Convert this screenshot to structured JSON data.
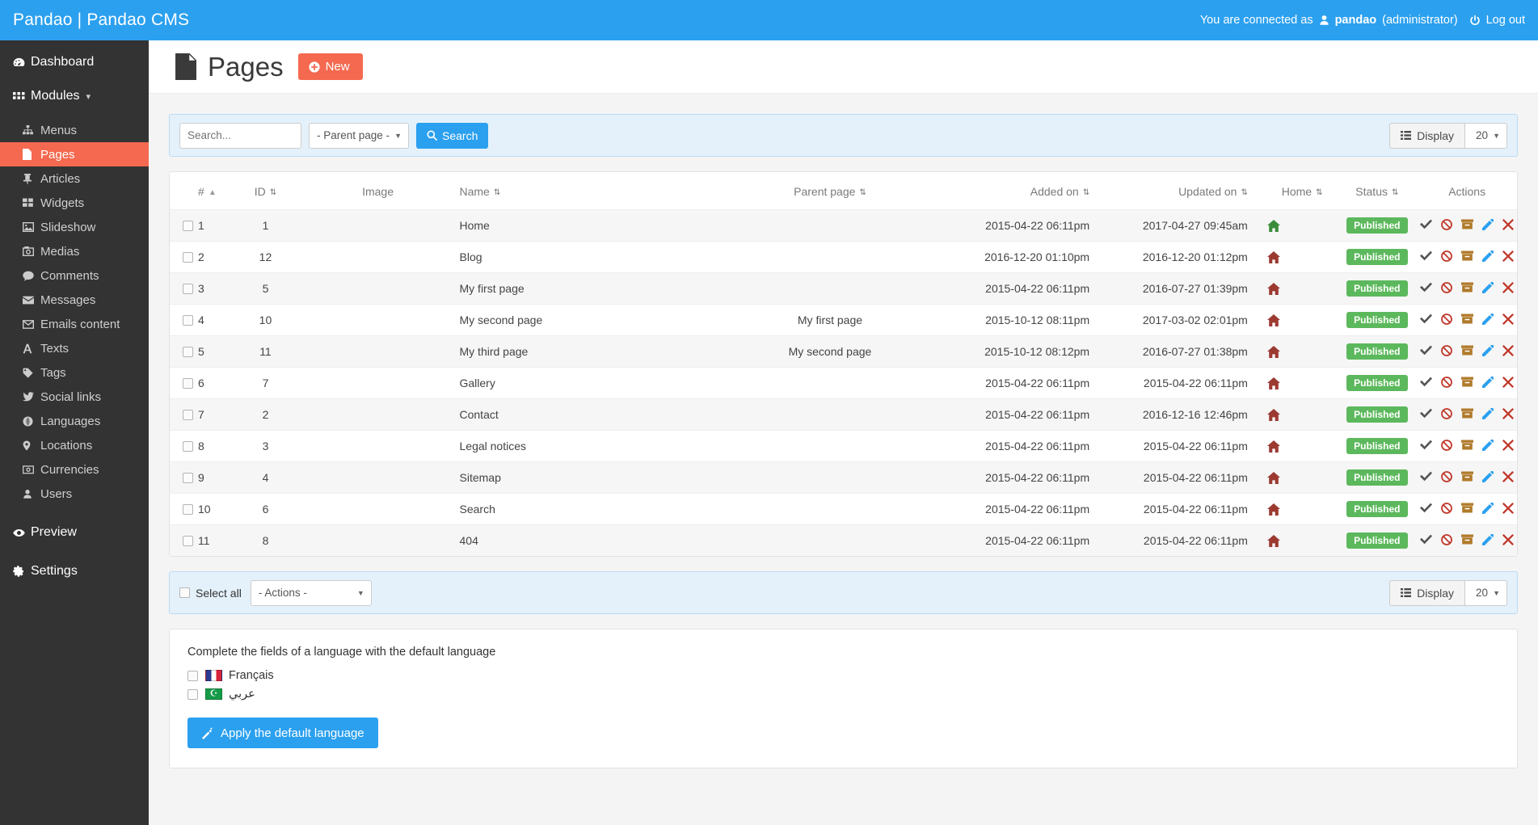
{
  "topbar": {
    "brand": "Pandao | Pandao CMS",
    "connected_label": "You are connected as",
    "user_icon": "user-icon",
    "username": "pandao",
    "role": "(administrator)",
    "power_icon": "power-icon",
    "logout_label": "Log out",
    "bg_color": "#2ba0ef"
  },
  "sidebar": {
    "bg_color": "#333333",
    "active_color": "#f4694f",
    "items": [
      {
        "label": "Dashboard",
        "icon": "dashboard-icon",
        "level": "top"
      },
      {
        "label": "Modules",
        "icon": "grid-icon",
        "level": "top",
        "caret": "chevron-down-icon"
      },
      {
        "label": "Menus",
        "icon": "sitemap-icon",
        "level": "sub"
      },
      {
        "label": "Pages",
        "icon": "page-icon",
        "level": "sub",
        "active": true
      },
      {
        "label": "Articles",
        "icon": "pin-icon",
        "level": "sub"
      },
      {
        "label": "Widgets",
        "icon": "widgets-icon",
        "level": "sub"
      },
      {
        "label": "Slideshow",
        "icon": "image-icon",
        "level": "sub"
      },
      {
        "label": "Medias",
        "icon": "camera-icon",
        "level": "sub"
      },
      {
        "label": "Comments",
        "icon": "comment-icon",
        "level": "sub"
      },
      {
        "label": "Messages",
        "icon": "envelope-icon",
        "level": "sub"
      },
      {
        "label": "Emails content",
        "icon": "envelope-open-icon",
        "level": "sub"
      },
      {
        "label": "Texts",
        "icon": "font-icon",
        "level": "sub"
      },
      {
        "label": "Tags",
        "icon": "tag-icon",
        "level": "sub"
      },
      {
        "label": "Social links",
        "icon": "twitter-icon",
        "level": "sub"
      },
      {
        "label": "Languages",
        "icon": "globe-icon",
        "level": "sub"
      },
      {
        "label": "Locations",
        "icon": "map-pin-icon",
        "level": "sub"
      },
      {
        "label": "Currencies",
        "icon": "money-icon",
        "level": "sub"
      },
      {
        "label": "Users",
        "icon": "user-icon",
        "level": "sub"
      },
      {
        "label": "Preview",
        "icon": "eye-icon",
        "level": "top"
      },
      {
        "label": "Settings",
        "icon": "gear-icon",
        "level": "top"
      }
    ]
  },
  "page": {
    "title": "Pages",
    "title_icon": "page-icon",
    "new_button": "New",
    "new_button_icon": "plus-circle-icon",
    "new_button_color": "#f4694f"
  },
  "search": {
    "placeholder": "Search...",
    "value": "",
    "parent_select": "- Parent page -",
    "search_button": "Search",
    "search_icon": "search-icon",
    "display_label": "Display",
    "display_icon": "list-icon",
    "display_count": "20"
  },
  "table": {
    "columns": [
      {
        "label": "#",
        "sort": "asc"
      },
      {
        "label": "ID",
        "sort": "both"
      },
      {
        "label": "Image",
        "sort": "none"
      },
      {
        "label": "Name",
        "sort": "both"
      },
      {
        "label": "Parent page",
        "sort": "both"
      },
      {
        "label": "Added on",
        "sort": "both"
      },
      {
        "label": "Updated on",
        "sort": "both"
      },
      {
        "label": "Home",
        "sort": "both"
      },
      {
        "label": "Status",
        "sort": "both"
      },
      {
        "label": "Actions",
        "sort": "none"
      }
    ],
    "rows": [
      {
        "num": "1",
        "id": "1",
        "image": "",
        "name": "Home",
        "parent": "",
        "added": "2015-04-22 06:11pm",
        "updated": "2017-04-27 09:45am",
        "home": "home-icon-active",
        "status": "Published"
      },
      {
        "num": "2",
        "id": "12",
        "image": "",
        "name": "Blog",
        "parent": "",
        "added": "2016-12-20 01:10pm",
        "updated": "2016-12-20 01:12pm",
        "home": "home-icon",
        "status": "Published"
      },
      {
        "num": "3",
        "id": "5",
        "image": "",
        "name": "My first page",
        "parent": "",
        "added": "2015-04-22 06:11pm",
        "updated": "2016-07-27 01:39pm",
        "home": "home-icon",
        "status": "Published"
      },
      {
        "num": "4",
        "id": "10",
        "image": "",
        "name": "My second page",
        "parent": "My first page",
        "added": "2015-10-12 08:11pm",
        "updated": "2017-03-02 02:01pm",
        "home": "home-icon",
        "status": "Published"
      },
      {
        "num": "5",
        "id": "11",
        "image": "",
        "name": "My third page",
        "parent": "My second page",
        "added": "2015-10-12 08:12pm",
        "updated": "2016-07-27 01:38pm",
        "home": "home-icon",
        "status": "Published"
      },
      {
        "num": "6",
        "id": "7",
        "image": "",
        "name": "Gallery",
        "parent": "",
        "added": "2015-04-22 06:11pm",
        "updated": "2015-04-22 06:11pm",
        "home": "home-icon",
        "status": "Published"
      },
      {
        "num": "7",
        "id": "2",
        "image": "",
        "name": "Contact",
        "parent": "",
        "added": "2015-04-22 06:11pm",
        "updated": "2016-12-16 12:46pm",
        "home": "home-icon",
        "status": "Published"
      },
      {
        "num": "8",
        "id": "3",
        "image": "",
        "name": "Legal notices",
        "parent": "",
        "added": "2015-04-22 06:11pm",
        "updated": "2015-04-22 06:11pm",
        "home": "home-icon",
        "status": "Published"
      },
      {
        "num": "9",
        "id": "4",
        "image": "",
        "name": "Sitemap",
        "parent": "",
        "added": "2015-04-22 06:11pm",
        "updated": "2015-04-22 06:11pm",
        "home": "home-icon",
        "status": "Published"
      },
      {
        "num": "10",
        "id": "6",
        "image": "",
        "name": "Search",
        "parent": "",
        "added": "2015-04-22 06:11pm",
        "updated": "2015-04-22 06:11pm",
        "home": "home-icon",
        "status": "Published"
      },
      {
        "num": "11",
        "id": "8",
        "image": "",
        "name": "404",
        "parent": "",
        "added": "2015-04-22 06:11pm",
        "updated": "2015-04-22 06:11pm",
        "home": "home-icon",
        "status": "Published"
      }
    ],
    "row_action_icons": [
      "check-icon",
      "ban-icon",
      "archive-icon",
      "pencil-icon",
      "delete-icon"
    ],
    "status_color": "#5cb85c"
  },
  "bottombar": {
    "select_all": "Select all",
    "actions_select": "- Actions -",
    "display_label": "Display",
    "display_icon": "list-icon",
    "display_count": "20"
  },
  "language_panel": {
    "title": "Complete the fields of a language with the default language",
    "languages": [
      {
        "label": "Français",
        "flag": "flag-france",
        "checked": false
      },
      {
        "label": "عربي",
        "flag": "flag-algeria",
        "checked": false
      }
    ],
    "apply_button": "Apply the default language",
    "apply_button_icon": "magic-wand-icon",
    "apply_button_color": "#2ba0ef"
  }
}
